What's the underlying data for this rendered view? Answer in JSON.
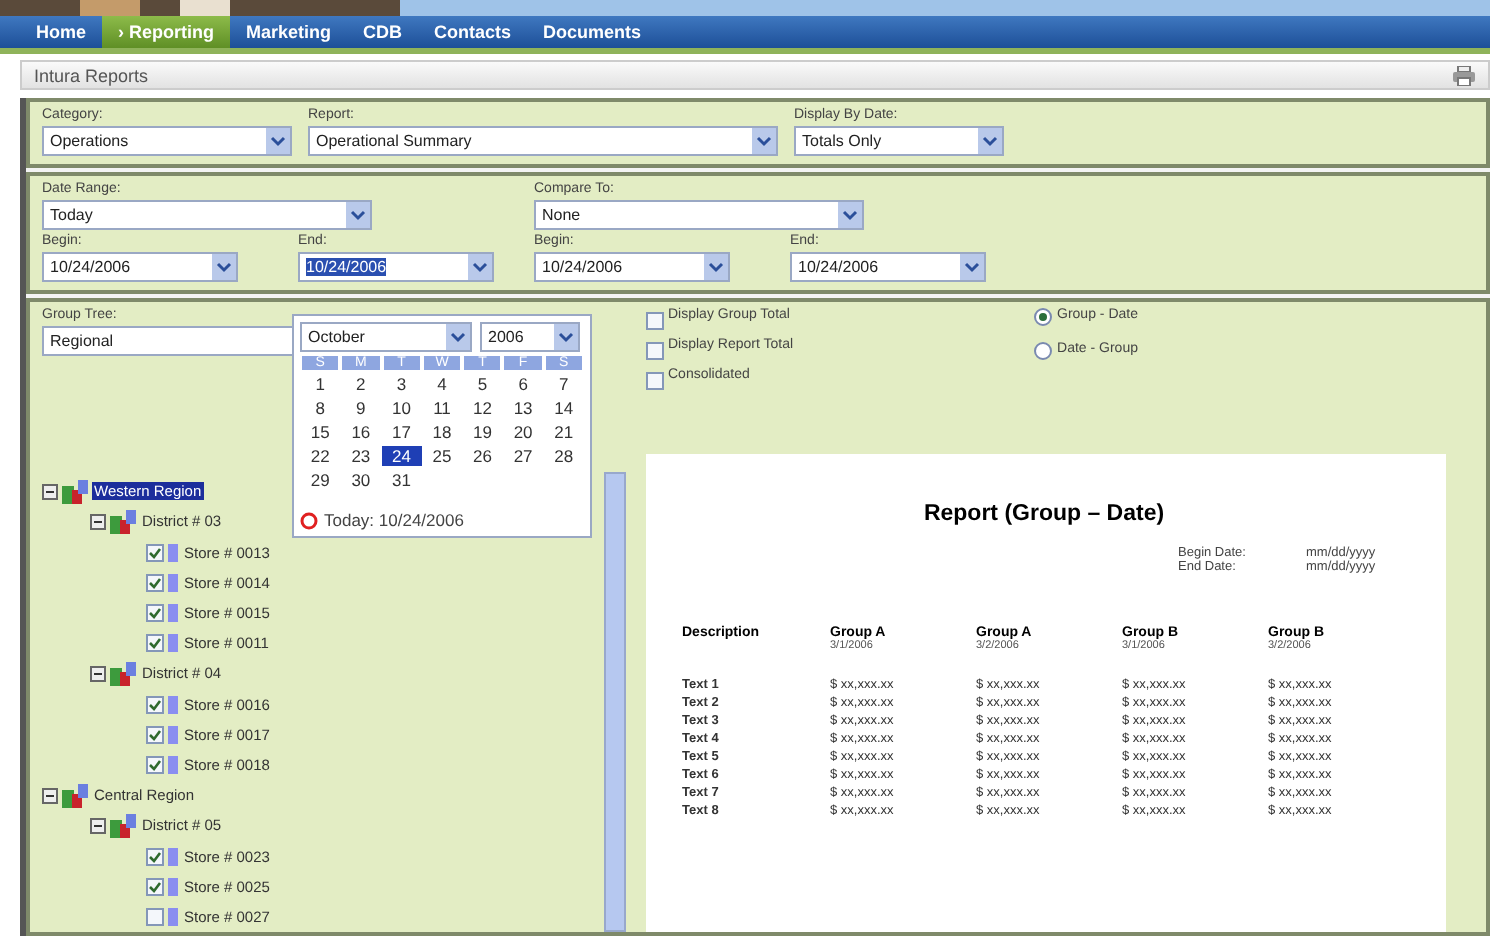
{
  "nav": [
    {
      "label": "Home",
      "selected": false
    },
    {
      "label": "› Reporting",
      "selected": true
    },
    {
      "label": "Marketing",
      "selected": false
    },
    {
      "label": "CDB",
      "selected": false
    },
    {
      "label": "Contacts",
      "selected": false
    },
    {
      "label": "Documents",
      "selected": false
    }
  ],
  "page_title": "Intura Reports",
  "filters": [
    {
      "label": "Category:",
      "value": "Operations"
    },
    {
      "label": "Report:",
      "value": "Operational Summary"
    },
    {
      "label": "Display By Date:",
      "value": "Totals Only"
    }
  ],
  "date_range": {
    "label": "Date Range:",
    "value": "Today",
    "begin_label": "Begin:",
    "begin": "10/24/2006",
    "end_label": "End:",
    "end": "10/24/2006"
  },
  "compare_to": {
    "label": "Compare To:",
    "value": "None",
    "begin_label": "Begin:",
    "begin": "10/24/2006",
    "end_label": "End:",
    "end": "10/24/2006"
  },
  "group_tree": {
    "label": "Group Tree:",
    "value": "Regional"
  },
  "options": [
    {
      "label": "Display Group Total",
      "checked": false
    },
    {
      "label": "Display Report Total",
      "checked": false
    },
    {
      "label": "Consolidated",
      "checked": false
    }
  ],
  "order": [
    {
      "label": "Group - Date",
      "selected": true
    },
    {
      "label": "Date - Group",
      "selected": false
    }
  ],
  "calendar": {
    "month": "October",
    "year": "2006",
    "weekdays": [
      "S",
      "M",
      "T",
      "W",
      "T",
      "F",
      "S"
    ],
    "days": [
      {
        "day": "1",
        "selected": false
      },
      {
        "day": "2",
        "selected": false
      },
      {
        "day": "3",
        "selected": false
      },
      {
        "day": "4",
        "selected": false
      },
      {
        "day": "5",
        "selected": false
      },
      {
        "day": "6",
        "selected": false
      },
      {
        "day": "7",
        "selected": false
      },
      {
        "day": "8",
        "selected": false
      },
      {
        "day": "9",
        "selected": false
      },
      {
        "day": "10",
        "selected": false
      },
      {
        "day": "11",
        "selected": false
      },
      {
        "day": "12",
        "selected": false
      },
      {
        "day": "13",
        "selected": false
      },
      {
        "day": "14",
        "selected": false
      },
      {
        "day": "15",
        "selected": false
      },
      {
        "day": "16",
        "selected": false
      },
      {
        "day": "17",
        "selected": false
      },
      {
        "day": "18",
        "selected": false
      },
      {
        "day": "19",
        "selected": false
      },
      {
        "day": "20",
        "selected": false
      },
      {
        "day": "21",
        "selected": false
      },
      {
        "day": "22",
        "selected": false
      },
      {
        "day": "23",
        "selected": false
      },
      {
        "day": "24",
        "selected": true
      },
      {
        "day": "25",
        "selected": false
      },
      {
        "day": "26",
        "selected": false
      },
      {
        "day": "27",
        "selected": false
      },
      {
        "day": "28",
        "selected": false
      },
      {
        "day": "29",
        "selected": false
      },
      {
        "day": "30",
        "selected": false
      },
      {
        "day": "31",
        "selected": false
      }
    ],
    "today": "Today: 10/24/2006"
  },
  "tree": [
    {
      "kind": "region",
      "label": "Western Region",
      "selected": true,
      "expanded": true,
      "children": [
        {
          "kind": "district",
          "label": "District # 03",
          "selected": false,
          "expanded": true,
          "children": [
            {
              "kind": "store",
              "label": "Store # 0013",
              "checked": true
            },
            {
              "kind": "store",
              "label": "Store # 0014",
              "checked": true
            },
            {
              "kind": "store",
              "label": "Store # 0015",
              "checked": true
            },
            {
              "kind": "store",
              "label": "Store # 0011",
              "checked": true
            }
          ]
        },
        {
          "kind": "district",
          "label": "District # 04",
          "selected": false,
          "expanded": true,
          "children": [
            {
              "kind": "store",
              "label": "Store # 0016",
              "checked": true
            },
            {
              "kind": "store",
              "label": "Store # 0017",
              "checked": true
            },
            {
              "kind": "store",
              "label": "Store # 0018",
              "checked": true
            }
          ]
        }
      ]
    },
    {
      "kind": "region",
      "label": "Central Region",
      "selected": false,
      "expanded": true,
      "children": [
        {
          "kind": "district",
          "label": "District # 05",
          "selected": false,
          "expanded": true,
          "children": [
            {
              "kind": "store",
              "label": "Store # 0023",
              "checked": true
            },
            {
              "kind": "store",
              "label": "Store # 0025",
              "checked": true
            },
            {
              "kind": "store",
              "label": "Store # 0027",
              "checked": false
            }
          ]
        }
      ]
    }
  ],
  "report": {
    "title": "Report (Group – Date)",
    "meta": [
      {
        "label": "Begin Date:",
        "value": "mm/dd/yyyy"
      },
      {
        "label": "End Date:",
        "value": "mm/dd/yyyy"
      }
    ],
    "columns": [
      {
        "name": "Description"
      },
      {
        "name": "Group A",
        "date": "3/1/2006"
      },
      {
        "name": "Group A",
        "date": "3/2/2006"
      },
      {
        "name": "Group B",
        "date": "3/1/2006"
      },
      {
        "name": "Group B",
        "date": "3/2/2006"
      }
    ],
    "rows": [
      [
        "Text 1",
        "$ xx,xxx.xx",
        "$ xx,xxx.xx",
        "$ xx,xxx.xx",
        "$ xx,xxx.xx"
      ],
      [
        "Text 2",
        "$ xx,xxx.xx",
        "$ xx,xxx.xx",
        "$ xx,xxx.xx",
        "$ xx,xxx.xx"
      ],
      [
        "Text 3",
        "$ xx,xxx.xx",
        "$ xx,xxx.xx",
        "$ xx,xxx.xx",
        "$ xx,xxx.xx"
      ],
      [
        "Text 4",
        "$ xx,xxx.xx",
        "$ xx,xxx.xx",
        "$ xx,xxx.xx",
        "$ xx,xxx.xx"
      ],
      [
        "Text 5",
        "$ xx,xxx.xx",
        "$ xx,xxx.xx",
        "$ xx,xxx.xx",
        "$ xx,xxx.xx"
      ],
      [
        "Text 6",
        "$ xx,xxx.xx",
        "$ xx,xxx.xx",
        "$ xx,xxx.xx",
        "$ xx,xxx.xx"
      ],
      [
        "Text 7",
        "$ xx,xxx.xx",
        "$ xx,xxx.xx",
        "$ xx,xxx.xx",
        "$ xx,xxx.xx"
      ],
      [
        "Text 8",
        "$ xx,xxx.xx",
        "$ xx,xxx.xx",
        "$ xx,xxx.xx",
        "$ xx,xxx.xx"
      ]
    ]
  }
}
